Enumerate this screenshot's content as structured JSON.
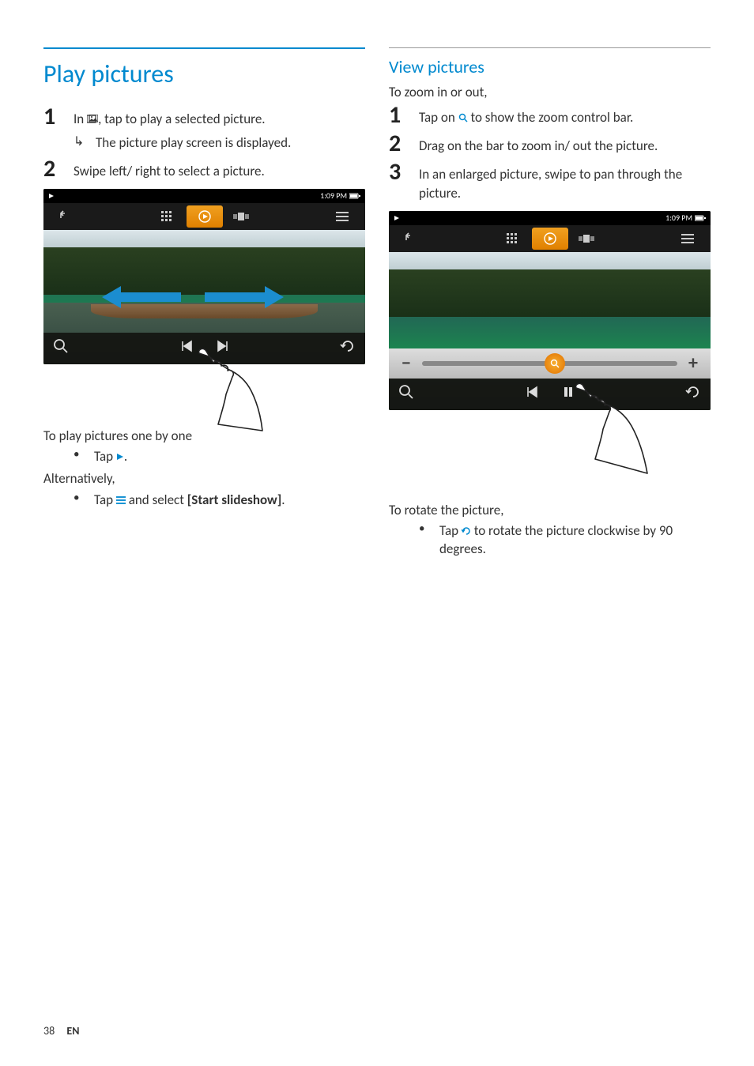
{
  "left": {
    "h1": "Play pictures",
    "step1_a": "In ",
    "step1_b": ", tap to play a selected picture.",
    "step1_result": "The picture play screen is displayed.",
    "step2": "Swipe left/ right to select a picture.",
    "shot": {
      "time": "1:09 PM"
    },
    "sub_onebyone": "To play pictures one by one",
    "bullet_tap_play_a": "Tap ",
    "bullet_tap_play_b": ".",
    "alt": "Alternatively,",
    "bullet_tap_menu_a": "Tap ",
    "bullet_tap_menu_b": " and select ",
    "bullet_tap_menu_c": "[Start slideshow]",
    "bullet_tap_menu_d": "."
  },
  "right": {
    "h2": "View pictures",
    "sub_zoom": "To zoom in or out,",
    "step1_a": "Tap on ",
    "step1_b": " to show the zoom control bar.",
    "step2": "Drag on the bar to zoom in/ out the picture.",
    "step3": "In an enlarged picture, swipe to pan through the picture.",
    "shot": {
      "time": "1:09 PM"
    },
    "sub_rotate": "To rotate the picture,",
    "bullet_rotate_a": "Tap ",
    "bullet_rotate_b": " to rotate the picture clockwise by 90 degrees."
  },
  "footer": {
    "page": "38",
    "lang": "EN"
  }
}
